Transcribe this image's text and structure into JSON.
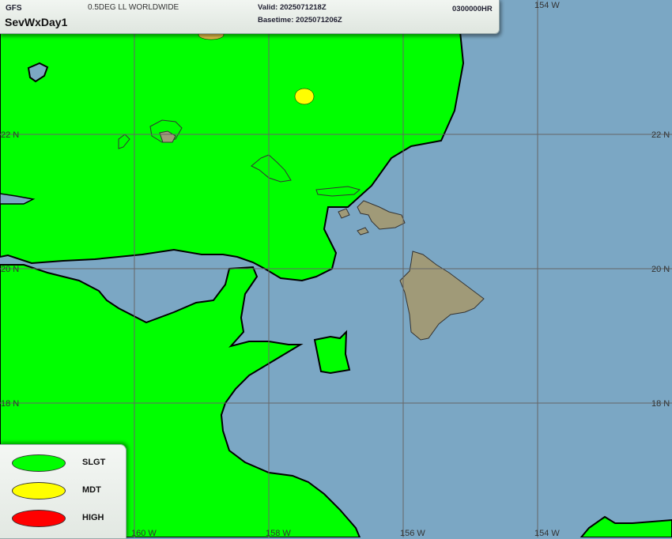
{
  "header": {
    "model": "GFS",
    "product": "SevWxDay1",
    "grid": "0.5DEG LL WORLDWIDE",
    "valid": "Valid: 2025071218Z",
    "basetime": "Basetime: 2025071206Z",
    "forecast_hour": "0300000HR"
  },
  "grid_labels": {
    "lon_160w": "160 W",
    "lon_158w": "158 W",
    "lon_156w": "156 W",
    "lon_154w": "154 W",
    "lat_22n": "22 N",
    "lat_20n": "20 N",
    "lat_18n": "18 N"
  },
  "legend": {
    "items": [
      {
        "label": "SLGT",
        "color": "#00ff00"
      },
      {
        "label": "MDT",
        "color": "#ffff00"
      },
      {
        "label": "HIGH",
        "color": "#ff0000"
      }
    ]
  },
  "colors": {
    "ocean": "#7ba7c4",
    "land": "#a09a78",
    "slgt": "#00ff00",
    "mdt": "#ffff00",
    "high": "#ff0000",
    "grid": "#666666"
  }
}
